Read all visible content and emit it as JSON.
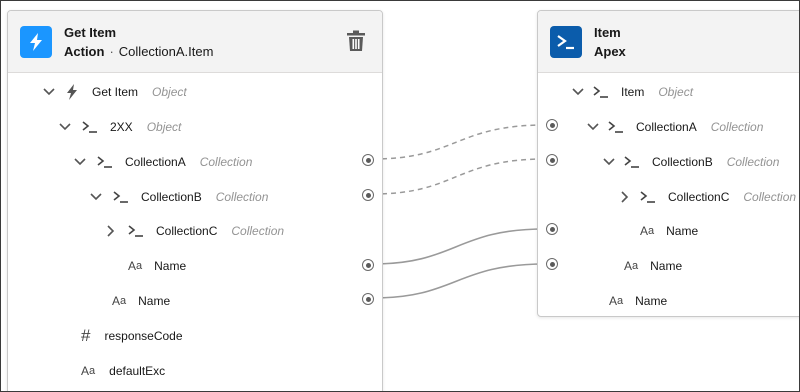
{
  "left_node": {
    "title": "Get Item",
    "subtitle_kind": "Action",
    "subtitle_separator": "·",
    "subtitle_path": "CollectionA.Item",
    "icon": "lightning-icon",
    "icon_color": "#1b96ff",
    "action_icon": "trash-icon",
    "rows": [
      {
        "label": "Get Item",
        "type": "Object",
        "icon": "lightning-icon",
        "chevron": "down"
      },
      {
        "label": "2XX",
        "type": "Object",
        "icon": "prompt-icon",
        "chevron": "down"
      },
      {
        "label": "CollectionA",
        "type": "Collection",
        "icon": "prompt-icon",
        "chevron": "down"
      },
      {
        "label": "CollectionB",
        "type": "Collection",
        "icon": "prompt-icon",
        "chevron": "down"
      },
      {
        "label": "CollectionC",
        "type": "Collection",
        "icon": "prompt-icon",
        "chevron": "right"
      },
      {
        "label": "Name",
        "type": "",
        "icon": "text-icon",
        "chevron": "none"
      },
      {
        "label": "Name",
        "type": "",
        "icon": "text-icon",
        "chevron": "none"
      },
      {
        "label": "responseCode",
        "type": "",
        "icon": "hash-icon",
        "chevron": "none"
      },
      {
        "label": "defaultExc",
        "type": "",
        "icon": "text-icon",
        "chevron": "none"
      }
    ]
  },
  "right_node": {
    "title": "Item",
    "subtitle": "Apex",
    "icon": "apex-icon",
    "icon_color": "#0b5cab",
    "rows": [
      {
        "label": "Item",
        "type": "Object",
        "icon": "prompt-icon",
        "chevron": "down"
      },
      {
        "label": "CollectionA",
        "type": "Collection",
        "icon": "prompt-icon",
        "chevron": "down"
      },
      {
        "label": "CollectionB",
        "type": "Collection",
        "icon": "prompt-icon",
        "chevron": "down"
      },
      {
        "label": "CollectionC",
        "type": "Collection",
        "icon": "prompt-icon",
        "chevron": "right"
      },
      {
        "label": "Name",
        "type": "",
        "icon": "text-icon",
        "chevron": "none"
      },
      {
        "label": "Name",
        "type": "",
        "icon": "text-icon",
        "chevron": "none"
      },
      {
        "label": "Name",
        "type": "",
        "icon": "text-icon",
        "chevron": "none"
      }
    ]
  },
  "text_icon_glyph": {
    "big": "A",
    "small": "a"
  },
  "hash_icon_glyph": "#",
  "connections": [
    {
      "from": "CollectionA",
      "to": "CollectionA",
      "style": "dashed"
    },
    {
      "from": "CollectionB",
      "to": "CollectionB",
      "style": "dashed"
    },
    {
      "from": "Name",
      "to": "Name",
      "style": "solid"
    },
    {
      "from": "Name",
      "to": "Name",
      "style": "solid"
    }
  ]
}
